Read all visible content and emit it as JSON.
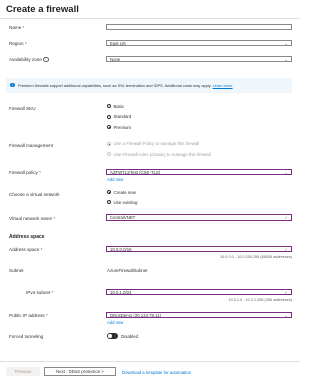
{
  "page": {
    "title": "Create a firewall"
  },
  "fields": {
    "name": {
      "label": "Name",
      "required": "*",
      "value": ""
    },
    "region": {
      "label": "Region",
      "required": "*",
      "value": "East US"
    },
    "availability_zone": {
      "label": "Availability zone",
      "value": "None"
    }
  },
  "banner": {
    "text": "Premium firewalls support additional capabilities, such as SSL termination and IDPS. Additional costs may apply.",
    "link": "Learn more"
  },
  "firewall_sku": {
    "label": "Firewall SKU",
    "options": [
      "Basic",
      "Standard",
      "Premium"
    ],
    "selected": "Premium"
  },
  "firewall_management": {
    "label": "Firewall management",
    "options": [
      "Use a Firewall Policy to manage this firewall",
      "Use Firewall rules (classic) to manage this firewall"
    ]
  },
  "firewall_policy": {
    "label": "Firewall policy",
    "required": "*",
    "value": "AZFWTLSTest (CXE-TLS)",
    "add_new": "Add new"
  },
  "virtual_network": {
    "label": "Choose a virtual network",
    "options": [
      "Create new",
      "Use existing"
    ],
    "selected": "Create new"
  },
  "vnet_name": {
    "label": "Virtual network name",
    "required": "*",
    "value": "CentralVNET"
  },
  "address_space": {
    "section_title": "Address space",
    "label": "Address space",
    "required": "*",
    "value": "10.0.0.0/16",
    "hint": "10.0.0.0 - 10.0.255.255 (65536 addresses)"
  },
  "subnet": {
    "label": "Subnet",
    "value": "AzureFirewallSubnet",
    "ipv4_label": "IPv4 subnet",
    "required": "*",
    "ipv4_value": "10.0.1.0/24",
    "hint": "10.0.1.0 - 10.0.1.255 (256 addresses)"
  },
  "public_ip": {
    "label": "Public IP address",
    "required": "*",
    "value": "DDosDemo (20.124.78.11)",
    "add_new": "Add new"
  },
  "forced_tunneling": {
    "label": "Forced tunneling",
    "state": "Disabled"
  },
  "footer": {
    "previous": "Previous",
    "next": "Next : DDoS protection >",
    "template_link": "Download a template for automation"
  }
}
